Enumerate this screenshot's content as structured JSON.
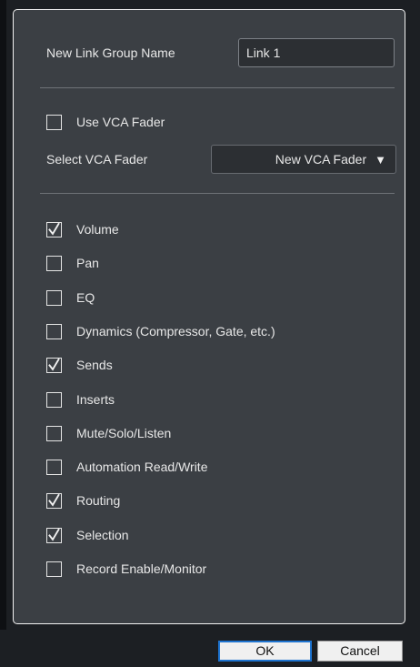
{
  "dialog": {
    "name_label": "New Link Group Name",
    "name_value": "Link 1",
    "use_vca_label": "Use VCA Fader",
    "use_vca_checked": false,
    "select_vca_label": "Select VCA Fader",
    "select_vca_value": "New VCA Fader",
    "caret": "▼",
    "options": [
      {
        "label": "Volume",
        "checked": true
      },
      {
        "label": "Pan",
        "checked": false
      },
      {
        "label": "EQ",
        "checked": false
      },
      {
        "label": "Dynamics (Compressor, Gate, etc.)",
        "checked": false
      },
      {
        "label": "Sends",
        "checked": true
      },
      {
        "label": "Inserts",
        "checked": false
      },
      {
        "label": "Mute/Solo/Listen",
        "checked": false
      },
      {
        "label": "Automation Read/Write",
        "checked": false
      },
      {
        "label": "Routing",
        "checked": true
      },
      {
        "label": "Selection",
        "checked": true
      },
      {
        "label": "Record Enable/Monitor",
        "checked": false
      }
    ]
  },
  "buttons": {
    "ok": "OK",
    "cancel": "Cancel"
  },
  "colors": {
    "panel": "#3b3f44",
    "background": "#1c1f23",
    "ok_border": "#1e74d0"
  }
}
